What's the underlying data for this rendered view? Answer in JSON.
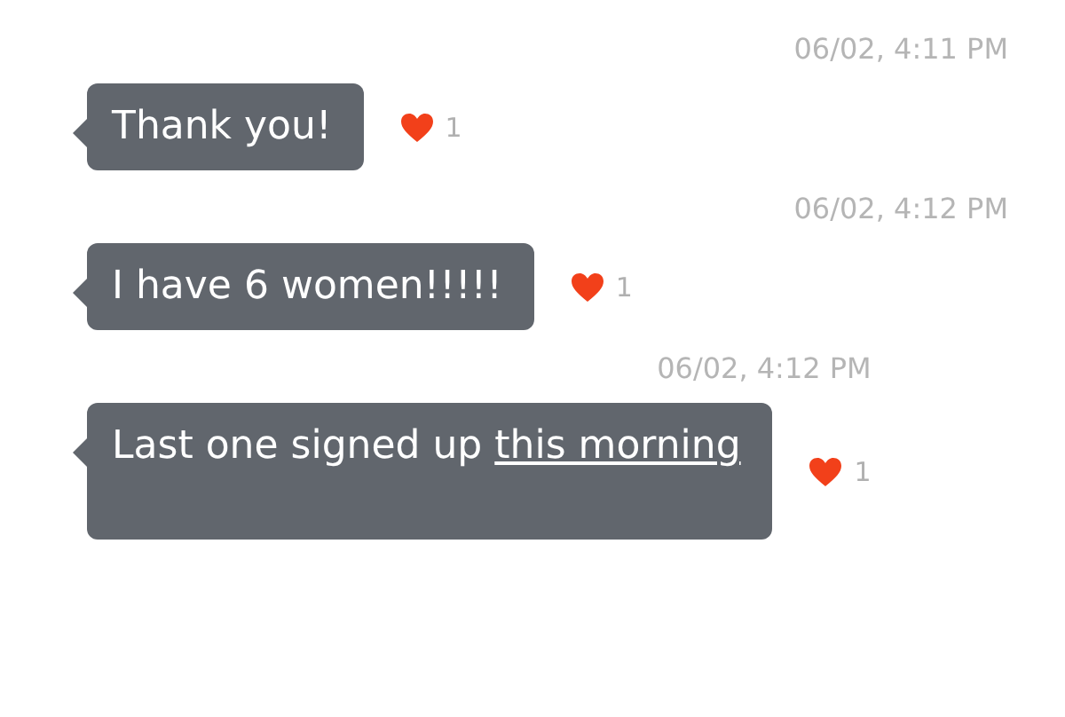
{
  "messages": [
    {
      "time": "06/02, 4:11 PM",
      "text": "Thank you!",
      "liked": true,
      "likes": "1"
    },
    {
      "time": "06/02, 4:12 PM",
      "text": "I have 6 women!!!!!",
      "liked": true,
      "likes": "1"
    },
    {
      "time": "06/02, 4:12 PM",
      "text": "Last one signed up ",
      "link": "this morning",
      "liked": true,
      "likes": "1"
    }
  ]
}
